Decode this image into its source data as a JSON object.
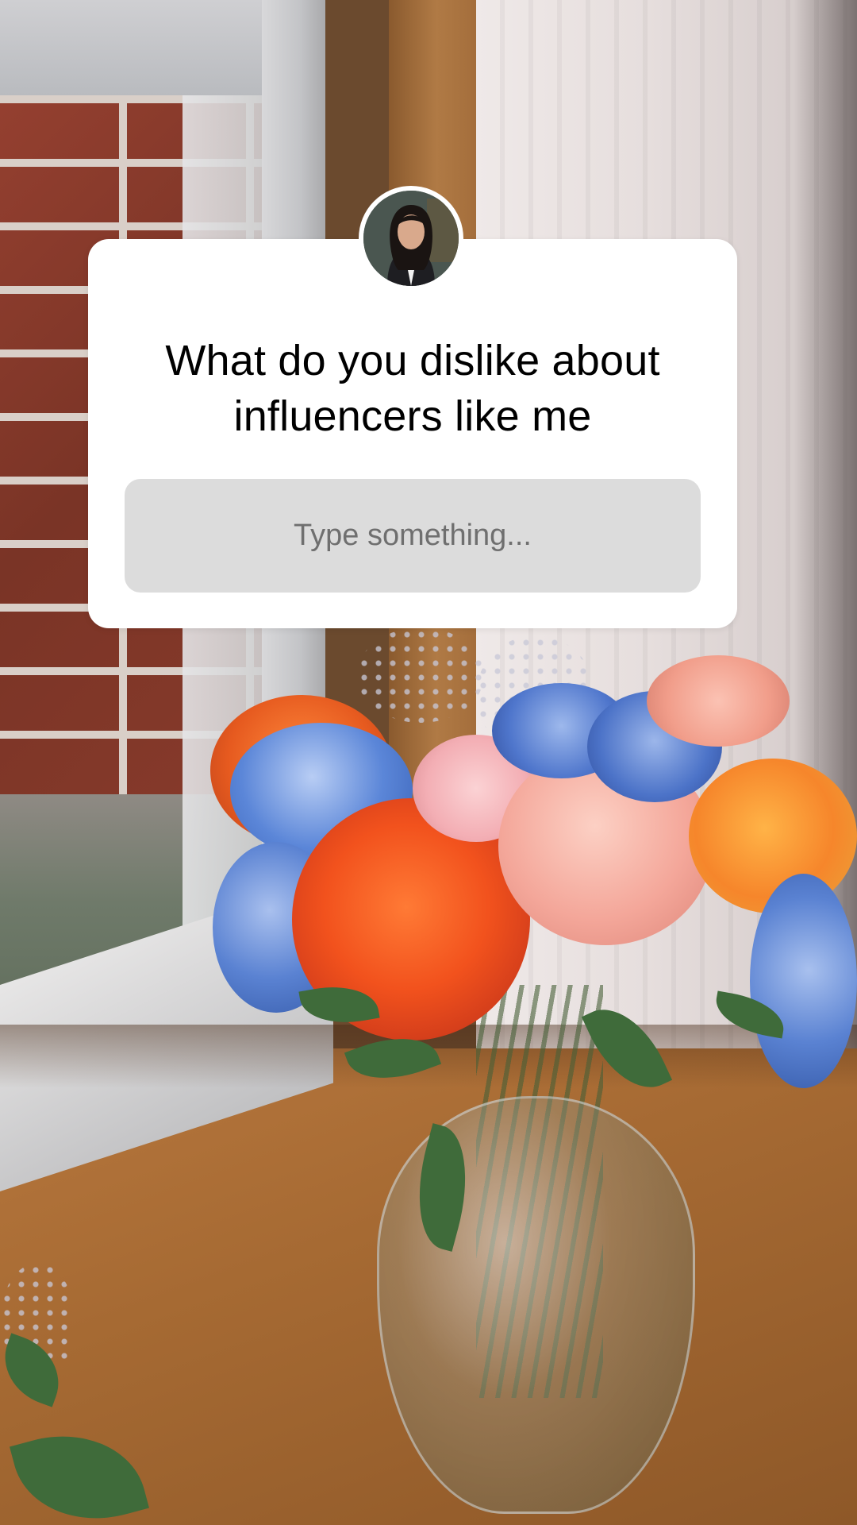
{
  "story": {
    "background_description_icon": "flower-vase-photo"
  },
  "question_sticker": {
    "question_line1": "What do you dislike about",
    "question_line2": "influencers like me",
    "input_placeholder": "Type something...",
    "avatar_icon": "profile-avatar",
    "card_color": "#ffffff",
    "field_color": "#dcdcdc",
    "placeholder_color": "#6f6f6f"
  }
}
